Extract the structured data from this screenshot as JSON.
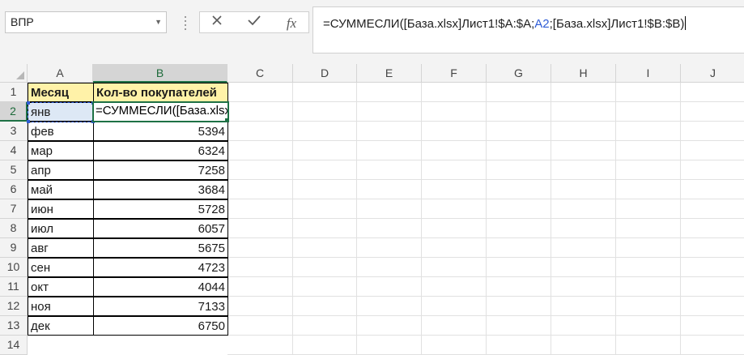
{
  "name_box": {
    "value": "ВПР",
    "dropdown_icon": "chevron-down-icon"
  },
  "formula_buttons": {
    "cancel_icon": "close-icon",
    "enter_icon": "check-icon",
    "fx_label": "fx"
  },
  "formula_bar": {
    "part1": "=СУММЕСЛИ([База.xlsx]Лист1!$A:$A;",
    "ref": "A2",
    "part2": ";[База.xlsx]Лист1!$B:$B)",
    "ref_color": "#2e5cd6"
  },
  "columns": [
    "A",
    "B",
    "C",
    "D",
    "E",
    "F",
    "G",
    "H",
    "I",
    "J"
  ],
  "rows": [
    "1",
    "2",
    "3",
    "4",
    "5",
    "6",
    "7",
    "8",
    "9",
    "10",
    "11",
    "12",
    "13",
    "14"
  ],
  "table": {
    "header": {
      "a": "Месяц",
      "b": "Кол-во покупателей"
    },
    "active_text": "=СУММЕСЛИ([База.xlsx]Лист1!$A:$A;A2;[База.xlsx]Лист1!$B:$B)",
    "rows": [
      {
        "a": "янв",
        "b": ""
      },
      {
        "a": "фев",
        "b": "5394"
      },
      {
        "a": "мар",
        "b": "6324"
      },
      {
        "a": "апр",
        "b": "7258"
      },
      {
        "a": "май",
        "b": "3684"
      },
      {
        "a": "июн",
        "b": "5728"
      },
      {
        "a": "июл",
        "b": "6057"
      },
      {
        "a": "авг",
        "b": "5675"
      },
      {
        "a": "сен",
        "b": "4723"
      },
      {
        "a": "окт",
        "b": "4044"
      },
      {
        "a": "ноя",
        "b": "7133"
      },
      {
        "a": "дек",
        "b": "6750"
      }
    ]
  },
  "colors": {
    "header_fill": "#fff2a8",
    "active_border": "#1e7145",
    "ref_highlight": "#dde8f5"
  }
}
